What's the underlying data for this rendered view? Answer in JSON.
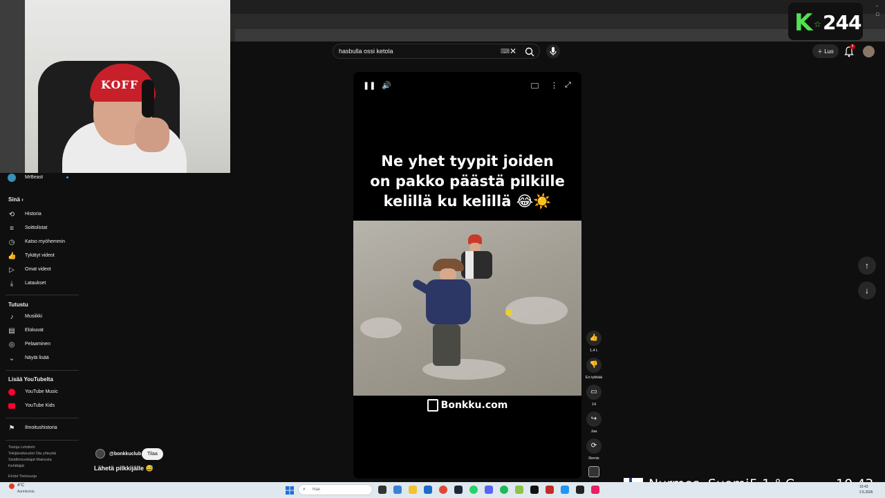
{
  "search": {
    "query": "hasbulla ossi ketola"
  },
  "header": {
    "create_label": "Luo",
    "notification_count": "9"
  },
  "logo": {
    "letter": "K",
    "star": "☆",
    "number": "244"
  },
  "webcam": {
    "cap_text": "KOFF"
  },
  "sidebar": {
    "subscription_item": "MrBeast",
    "you_heading": "Sinä",
    "you_items": [
      {
        "label": "Historia",
        "icon": "history-icon"
      },
      {
        "label": "Soittolistat",
        "icon": "playlists-icon"
      },
      {
        "label": "Katso myöhemmin",
        "icon": "watch-later-icon"
      },
      {
        "label": "Tykätyt videot",
        "icon": "liked-icon"
      },
      {
        "label": "Omat videot",
        "icon": "your-videos-icon"
      },
      {
        "label": "Lataukset",
        "icon": "downloads-icon"
      }
    ],
    "explore_heading": "Tutustu",
    "explore_items": [
      {
        "label": "Musiikki",
        "icon": "music-icon"
      },
      {
        "label": "Elokuvat",
        "icon": "movies-icon"
      },
      {
        "label": "Pelaaminen",
        "icon": "gaming-icon"
      },
      {
        "label": "Näytä lisää",
        "icon": "chevron-down-icon"
      }
    ],
    "more_heading": "Lisää YouTubelta",
    "more_items": [
      {
        "label": "YouTube Music",
        "icon": "youtube-music-icon"
      },
      {
        "label": "YouTube Kids",
        "icon": "youtube-kids-icon"
      }
    ],
    "report_item": "Ilmoitushistoria",
    "footer": {
      "line1": "Tietoja  Lehdistö",
      "line2": "Tekijänoikeudet  Ota yhteyttä",
      "line3": "Sisällöntuottajat  Mainosta",
      "line4": "Kehittäjät",
      "line5": "Ehdot  Tietosuoja"
    }
  },
  "video": {
    "caption_line1": "Ne yhet tyypit joiden",
    "caption_line2": "on pakko päästä pilkille",
    "caption_line3": "kelillä ku kelillä 😂☀️",
    "brand": "Bonkku.com",
    "channel": "@bonkkuclub",
    "subscribe_label": "Tilaa",
    "title": "Lähetä pilkkijälle 😅"
  },
  "actions": {
    "like_count": "1,4 t.",
    "dislike_label": "En tykkää",
    "comment_count": "14",
    "share_label": "Jaa",
    "remix_label": "Remix"
  },
  "weather_overlay": {
    "location": "Nurmes, Suomi",
    "temp": "5.1 ° C",
    "time": "10.43"
  },
  "taskbar": {
    "temp": "4°C",
    "condition": "Aurinkoista",
    "search_placeholder": "Hae",
    "clock_time": "10.43",
    "clock_date": "2.5.2026"
  },
  "colors": {
    "background": "#0f0f0f",
    "accent_red": "#cc0000",
    "logo_green": "#53e053"
  }
}
